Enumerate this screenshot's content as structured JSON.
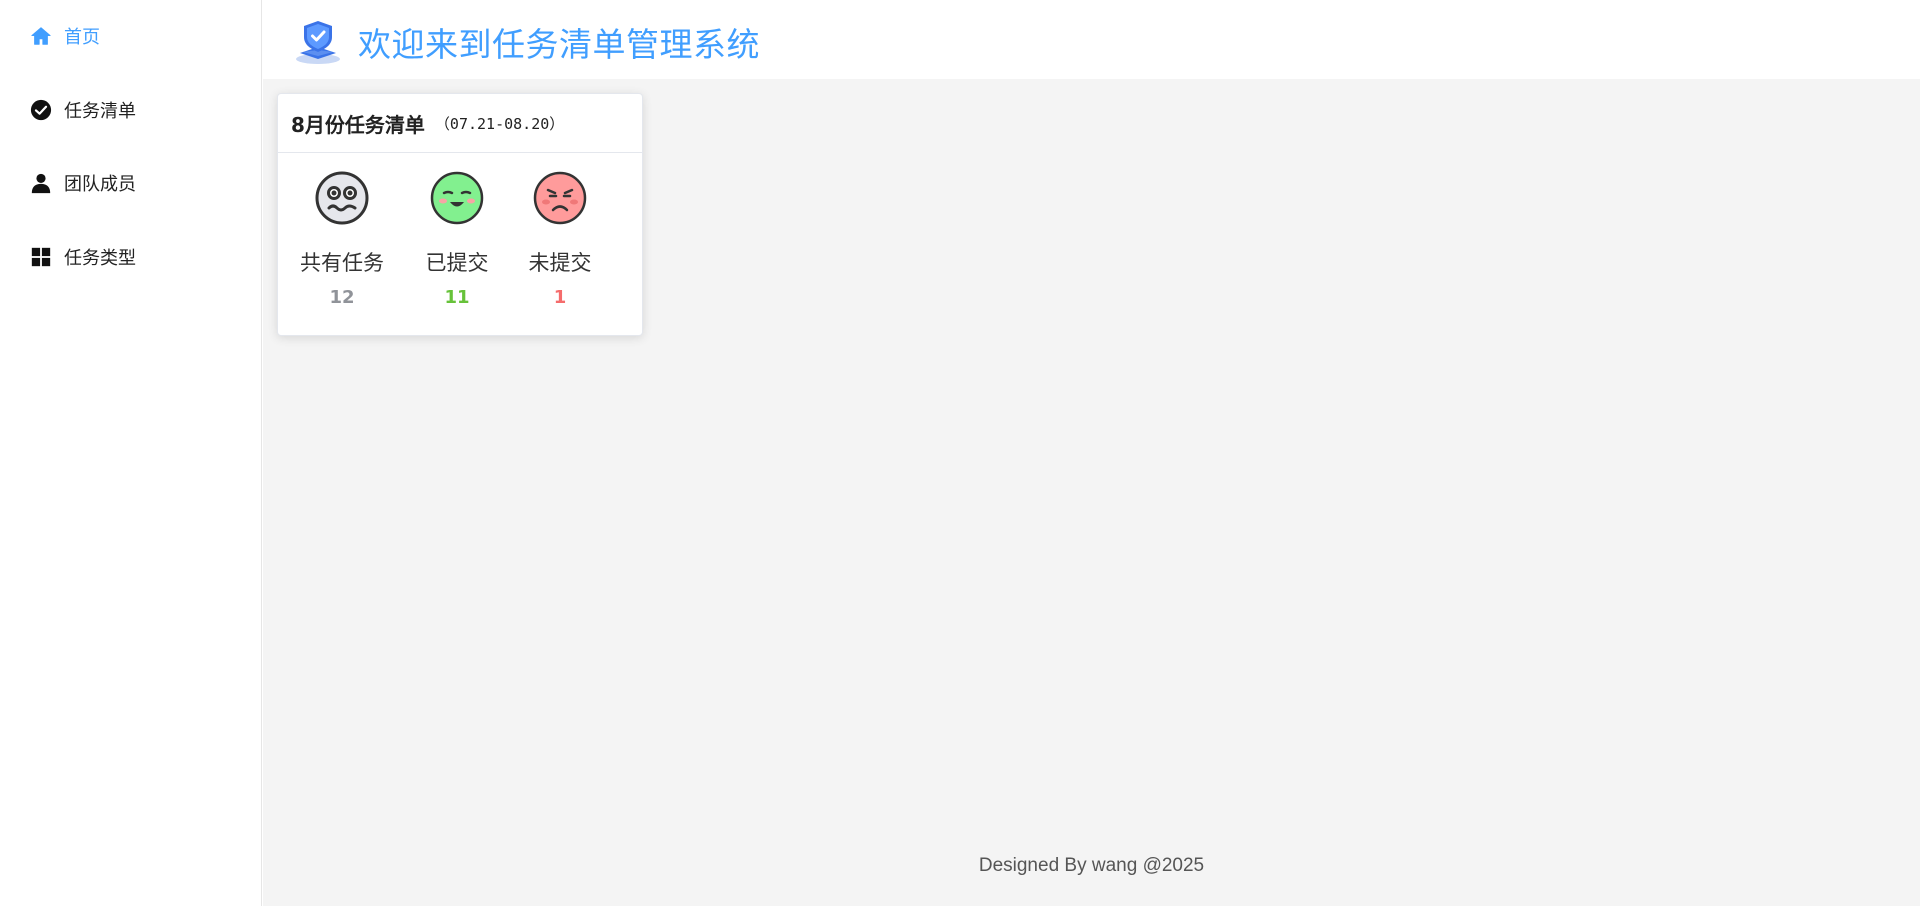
{
  "sidebar": {
    "items": [
      {
        "label": "首页",
        "icon": "home-icon",
        "active": true
      },
      {
        "label": "任务清单",
        "icon": "check-circle-icon",
        "active": false
      },
      {
        "label": "团队成员",
        "icon": "user-icon",
        "active": false
      },
      {
        "label": "任务类型",
        "icon": "grid-icon",
        "active": false
      }
    ]
  },
  "header": {
    "title": "欢迎来到任务清单管理系统",
    "logo_icon": "shield-check-icon"
  },
  "card": {
    "title": "8月份任务清单",
    "range": "（07.21-08.20）",
    "stats": [
      {
        "label": "共有任务",
        "value": "12",
        "color": "#909399",
        "icon": "worried-face-icon"
      },
      {
        "label": "已提交",
        "value": "11",
        "color": "#67c23a",
        "icon": "smiling-face-icon"
      },
      {
        "label": "未提交",
        "value": "1",
        "color": "#f56c6c",
        "icon": "angry-face-icon"
      }
    ]
  },
  "footer": {
    "text": "Designed By wang @2025"
  },
  "colors": {
    "accent": "#409eff",
    "background": "#f4f4f4"
  }
}
